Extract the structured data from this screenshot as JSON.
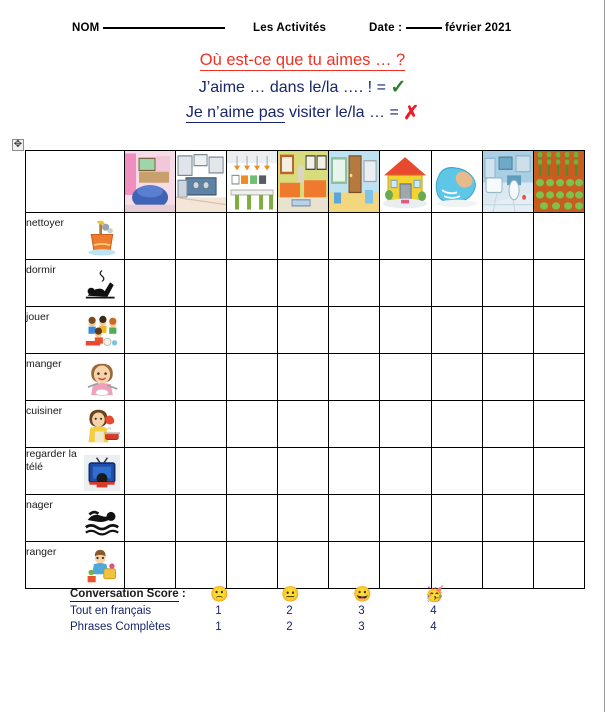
{
  "document": {
    "header": {
      "name_label": "NOM",
      "title": "Les Activités",
      "date_label": "Date :",
      "date_value": "février 2021"
    },
    "prompt": {
      "question": "Où est-ce que tu aimes … ?",
      "like_part1": "J’aime … dans le/la …. ! =",
      "like_symbol": "✓",
      "dislike_underlined": "Je n’aime pas",
      "dislike_rest": "visiter le/la … =",
      "dislike_symbol": "✗"
    },
    "table_handle_icon": "move-table-icon"
  },
  "grid": {
    "rooms": [
      {
        "name": "chambre",
        "icon": "bedroom-icon"
      },
      {
        "name": "cuisine",
        "icon": "kitchen-icon"
      },
      {
        "name": "salle-a-manger",
        "icon": "dining-room-icon"
      },
      {
        "name": "salon",
        "icon": "living-room-icon"
      },
      {
        "name": "entree",
        "icon": "hallway-icon"
      },
      {
        "name": "maison",
        "icon": "house-icon"
      },
      {
        "name": "piscine",
        "icon": "swimming-pool-icon"
      },
      {
        "name": "salle-de-bain",
        "icon": "bathroom-icon"
      },
      {
        "name": "jardin",
        "icon": "garden-icon"
      }
    ],
    "activities": [
      {
        "label": "nettoyer",
        "icon": "cleaning-bucket-icon"
      },
      {
        "label": "dormir",
        "icon": "sleeping-person-icon"
      },
      {
        "label": "jouer",
        "icon": "children-playing-icon"
      },
      {
        "label": "manger",
        "icon": "eating-girl-icon"
      },
      {
        "label": "cuisiner",
        "icon": "cooking-woman-icon"
      },
      {
        "label": "regarder la télé",
        "icon": "television-icon"
      },
      {
        "label": "nager",
        "icon": "swimmer-icon"
      },
      {
        "label": "ranger",
        "icon": "tidying-child-icon"
      }
    ]
  },
  "score": {
    "title": "Conversation Score",
    "title_colon": " :",
    "faces": [
      {
        "icon": "frowning-face-emoji",
        "glyph": "🙁"
      },
      {
        "icon": "neutral-face-emoji",
        "glyph": "😐"
      },
      {
        "icon": "grinning-face-emoji",
        "glyph": "😀"
      },
      {
        "icon": "party-face-emoji",
        "glyph": "🥳"
      }
    ],
    "rows": [
      {
        "label": "Tout en français",
        "values": [
          "1",
          "2",
          "3",
          "4"
        ]
      },
      {
        "label": "Phrases Complètes",
        "values": [
          "1",
          "2",
          "3",
          "4"
        ]
      }
    ]
  },
  "colors": {
    "question_red": "#ee3124",
    "sentence_blue": "#17266b",
    "check_green": "#2f7d32",
    "cross_red": "#ee1c25"
  }
}
